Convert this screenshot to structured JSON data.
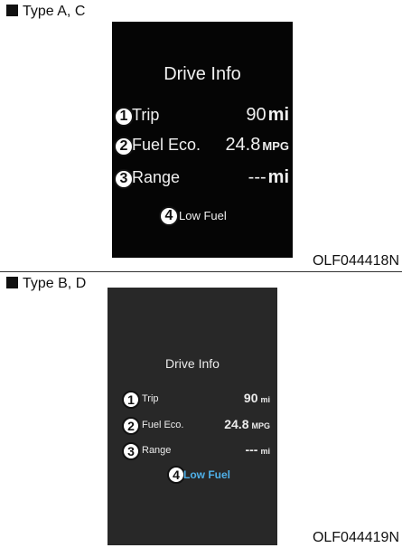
{
  "type_a": {
    "title": "Type A, C",
    "figure_code": "OLF044418N",
    "screen": {
      "title": "Drive Info",
      "rows": [
        {
          "badge": "1",
          "label": "Trip",
          "value": "90",
          "unit": "mi"
        },
        {
          "badge": "2",
          "label": "Fuel Eco.",
          "value": "24.8",
          "unit": "MPG"
        },
        {
          "badge": "3",
          "label": "Range",
          "value": "---",
          "unit": "mi"
        }
      ],
      "low_fuel": {
        "badge": "4",
        "label": "Low Fuel"
      }
    }
  },
  "type_b": {
    "title": "Type B, D",
    "figure_code": "OLF044419N",
    "screen": {
      "title": "Drive Info",
      "rows": [
        {
          "badge": "1",
          "label": "Trip",
          "value": "90",
          "unit": "mi"
        },
        {
          "badge": "2",
          "label": "Fuel Eco.",
          "value": "24.8",
          "unit": "MPG"
        },
        {
          "badge": "3",
          "label": "Range",
          "value": "---",
          "unit": "mi"
        }
      ],
      "low_fuel": {
        "badge": "4",
        "label": "Low Fuel"
      }
    }
  },
  "colors": {
    "screen_a_bg": "#050505",
    "screen_b_bg": "#282828",
    "low_fuel_b": "#4fb0e8"
  }
}
